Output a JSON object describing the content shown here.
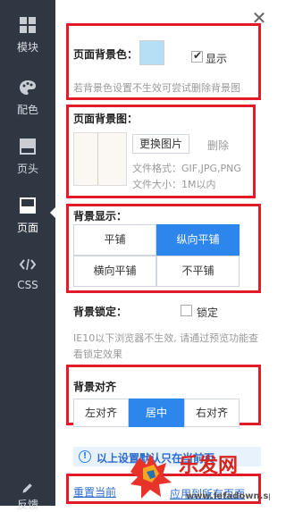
{
  "sidebar": {
    "items": [
      {
        "label": "模块",
        "icon": "grid-icon"
      },
      {
        "label": "配色",
        "icon": "palette-icon"
      },
      {
        "label": "页头",
        "icon": "header-icon"
      },
      {
        "label": "页面",
        "icon": "page-icon",
        "active": true
      },
      {
        "label": "CSS",
        "icon": "code-icon"
      }
    ],
    "feedback_label": "反馈"
  },
  "close_glyph": "✕",
  "bg_color": {
    "label": "页面背景色：",
    "swatch_color": "#b4dff4",
    "show_label": "显示",
    "show_checked": true,
    "hint": "若背景色设置不生效可尝试删除背景图"
  },
  "bg_image": {
    "label": "页面背景图：",
    "change_button": "更换图片",
    "delete_label": "删除",
    "format": "文件格式：GIF,JPG,PNG",
    "size": "文件大小：1M以内"
  },
  "bg_repeat": {
    "label": "背景显示：",
    "options": [
      "平铺",
      "纵向平铺",
      "横向平铺",
      "不平铺"
    ],
    "selected": "纵向平铺"
  },
  "bg_lock": {
    "label": "背景锁定：",
    "lock_label": "锁定",
    "checked": false,
    "note": "IE10以下浏览器不生效, 请通过预览功能查看锁定效果"
  },
  "bg_align": {
    "label": "背景对齐",
    "options": [
      "左对齐",
      "居中",
      "右对齐"
    ],
    "selected": "居中"
  },
  "notice": {
    "text": "以上设置默认只在当前页"
  },
  "footer": {
    "reset_label": "重置当前",
    "apply_label": "应用到所有页面"
  },
  "watermark": {
    "text": "乐发网",
    "url": "www.lefadown.spf.cn"
  }
}
